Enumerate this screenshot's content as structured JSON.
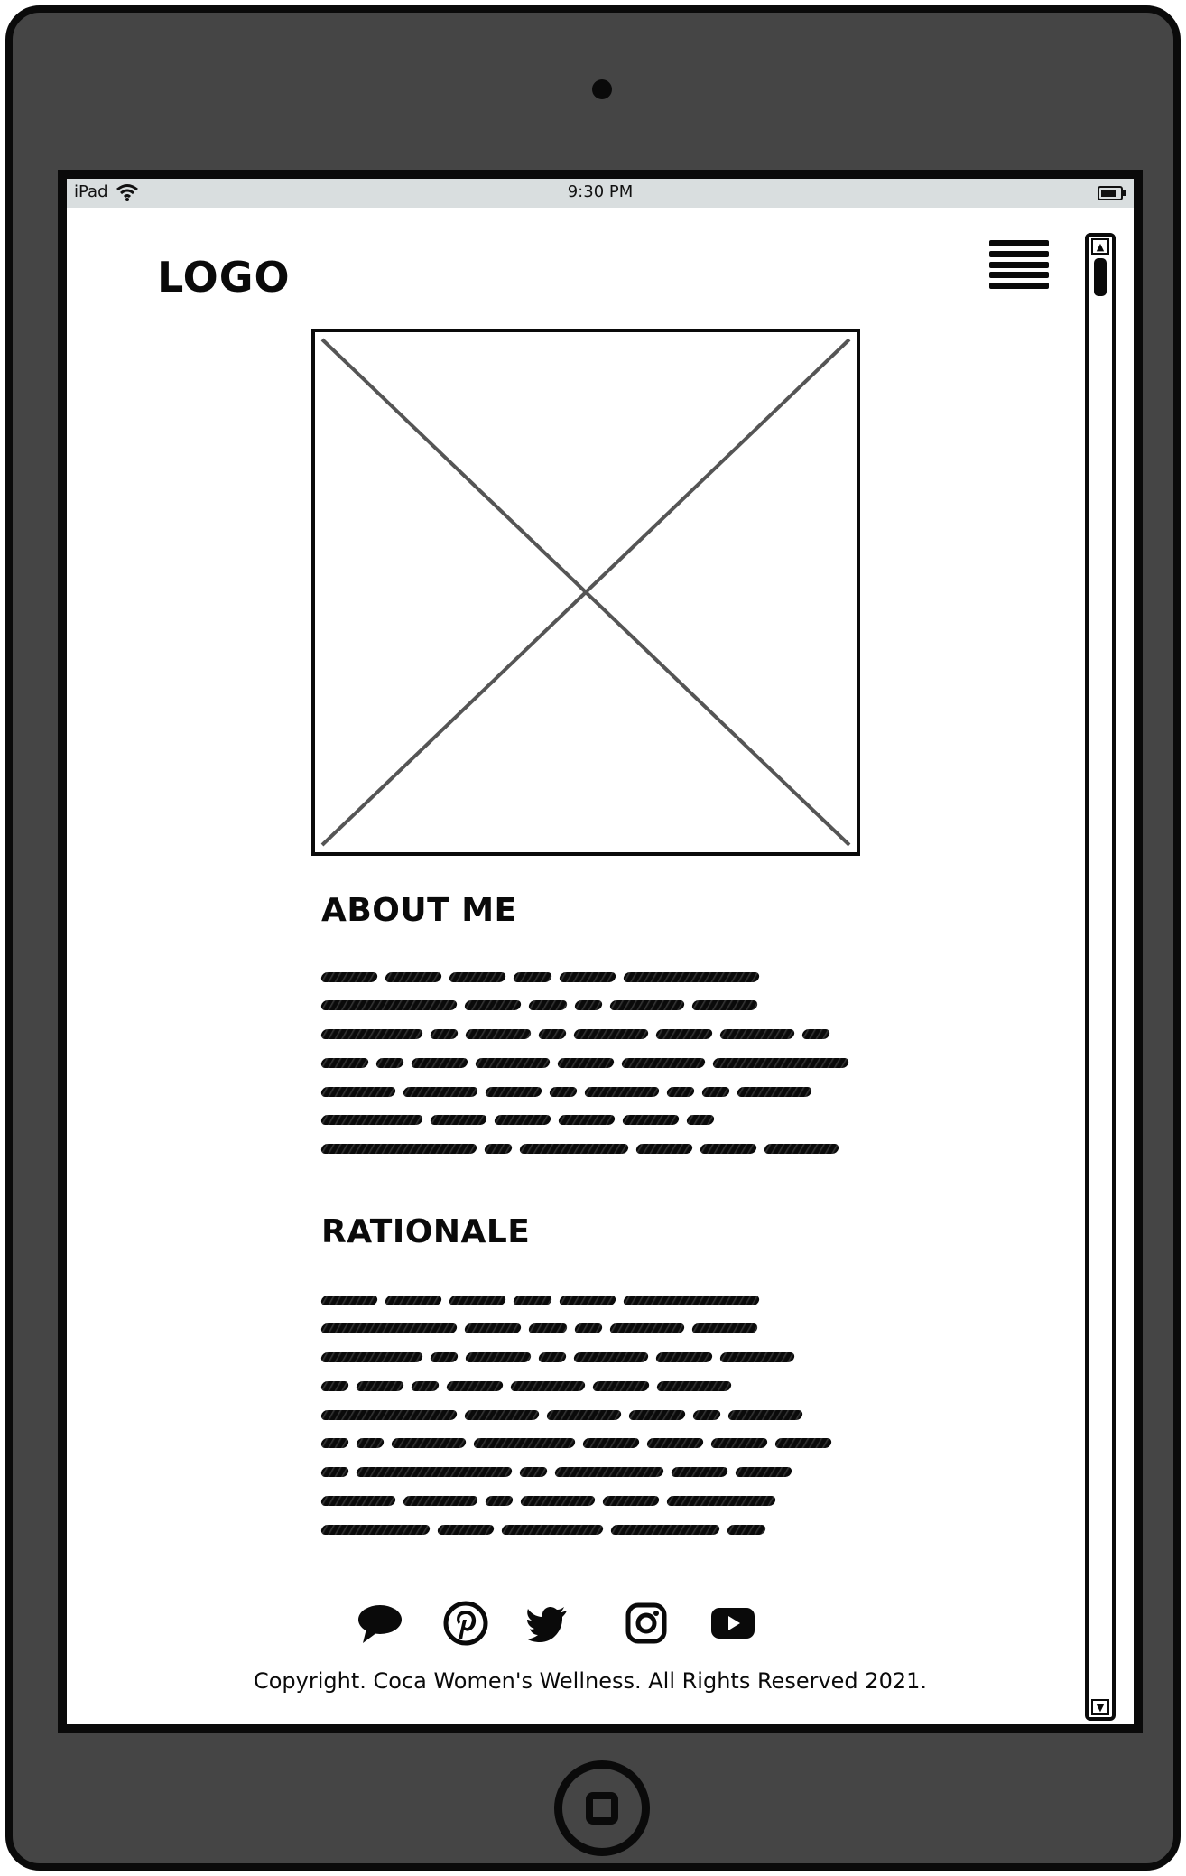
{
  "status_bar": {
    "device": "iPad",
    "time": "9:30 PM"
  },
  "header": {
    "logo": "LOGO"
  },
  "sections": {
    "about": {
      "title": "ABOUT ME"
    },
    "rationale": {
      "title": "RATIONALE"
    }
  },
  "social_icons": [
    "chat-bubble-icon",
    "pinterest-icon",
    "twitter-icon",
    "instagram-icon",
    "youtube-icon"
  ],
  "footer": {
    "copyright": "Copyright. Coca Women's Wellness. All Rights Reserved 2021."
  },
  "colors": {
    "device_body": "#454545",
    "status_bar": "#d9dedf",
    "ink": "#0a0a0a"
  }
}
